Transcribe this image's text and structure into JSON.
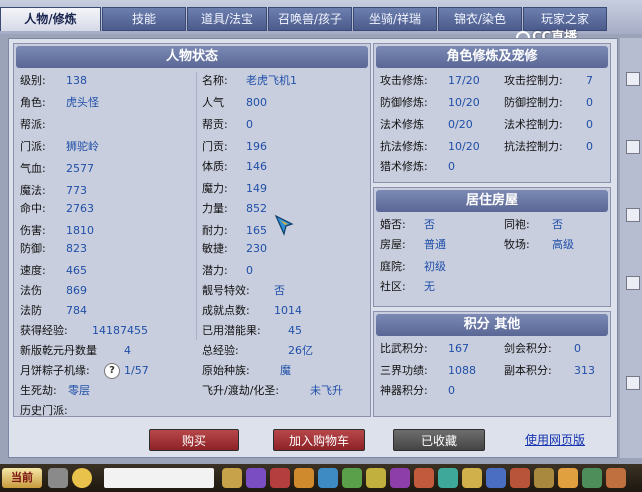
{
  "tabs": [
    {
      "label": "人物/修炼",
      "active": true
    },
    {
      "label": "技能"
    },
    {
      "label": "道具/法宝"
    },
    {
      "label": "召唤兽/孩子"
    },
    {
      "label": "坐骑/祥瑞"
    },
    {
      "label": "锦衣/染色"
    },
    {
      "label": "玩家之家"
    }
  ],
  "logo": {
    "text": "CC直播"
  },
  "character": {
    "title": "人物状态",
    "left": [
      {
        "label": "级别:",
        "value": "138"
      },
      {
        "label": "角色:",
        "value": "虎头怪"
      },
      {
        "label": "帮派:",
        "value": ""
      },
      {
        "label": "门派:",
        "value": "狮驼岭"
      },
      {
        "label": "气血:",
        "value": "2577"
      },
      {
        "label": "魔法:",
        "value": "773"
      },
      {
        "label": "命中:",
        "value": "2763"
      },
      {
        "label": "伤害:",
        "value": "1810"
      },
      {
        "label": "防御:",
        "value": "823"
      },
      {
        "label": "速度:",
        "value": "465"
      },
      {
        "label": "法伤",
        "value": "869"
      },
      {
        "label": "法防",
        "value": "784"
      }
    ],
    "right": [
      {
        "label": "名称:",
        "value": "老虎飞机1"
      },
      {
        "label": "人气",
        "value": "800"
      },
      {
        "label": "帮贡:",
        "value": "0"
      },
      {
        "label": "门贡:",
        "value": "196"
      },
      {
        "label": "体质:",
        "value": "146"
      },
      {
        "label": "魔力:",
        "value": "149"
      },
      {
        "label": "力量:",
        "value": "852"
      },
      {
        "label": "耐力:",
        "value": "165"
      },
      {
        "label": "敏捷:",
        "value": "230"
      },
      {
        "label": "潜力:",
        "value": "0"
      },
      {
        "label": "靓号特效:",
        "value": "否"
      },
      {
        "label": "成就点数:",
        "value": "1014"
      }
    ],
    "bottom": [
      {
        "l1": "获得经验:",
        "v1": "14187455",
        "l2": "已用潜能果:",
        "v2": "45"
      },
      {
        "l1": "新版乾元丹数量",
        "v1": "4",
        "l2": "总经验:",
        "v2": "26亿"
      },
      {
        "l1": "月饼粽子机缘:",
        "v1": "1/57",
        "l2": "原始种族:",
        "v2": "魔"
      },
      {
        "l1": "生死劫:",
        "v1": "零层",
        "l2": "飞升/渡劫/化圣:",
        "v2": "未飞升"
      },
      {
        "l1": "历史门派:",
        "v1": "",
        "l2": "",
        "v2": ""
      }
    ],
    "help_icon": "?"
  },
  "cultivation": {
    "title": "角色修炼及宠修",
    "rows": [
      {
        "l1": "攻击修炼:",
        "v1": "17/20",
        "l2": "攻击控制力:",
        "v2": "7"
      },
      {
        "l1": "防御修炼:",
        "v1": "10/20",
        "l2": "防御控制力:",
        "v2": "0"
      },
      {
        "l1": "法术修炼",
        "v1": "0/20",
        "l2": "法术控制力:",
        "v2": "0"
      },
      {
        "l1": "抗法修炼:",
        "v1": "10/20",
        "l2": "抗法控制力:",
        "v2": "0"
      },
      {
        "l1": "猎术修炼:",
        "v1": "0",
        "l2": "",
        "v2": ""
      }
    ]
  },
  "residence": {
    "title": "居住房屋",
    "rows": [
      {
        "l1": "婚否:",
        "v1": "否",
        "l2": "同袍:",
        "v2": "否"
      },
      {
        "l1": "房屋:",
        "v1": "普通",
        "l2": "牧场:",
        "v2": "高级"
      },
      {
        "l1": "庭院:",
        "v1": "初级",
        "l2": "",
        "v2": ""
      },
      {
        "l1": "社区:",
        "v1": "无",
        "l2": "",
        "v2": ""
      }
    ]
  },
  "points": {
    "title": "积分 其他",
    "rows": [
      {
        "l1": "比武积分:",
        "v1": "167",
        "l2": "剑会积分:",
        "v2": "0"
      },
      {
        "l1": "三界功绩:",
        "v1": "1088",
        "l2": "副本积分:",
        "v2": "313"
      },
      {
        "l1": "神器积分:",
        "v1": "0",
        "l2": "",
        "v2": ""
      }
    ]
  },
  "actions": {
    "buy": "购买",
    "add_cart": "加入购物车",
    "collected": "已收藏",
    "web_version": "使用网页版"
  },
  "taskbar": {
    "start": "当前"
  }
}
